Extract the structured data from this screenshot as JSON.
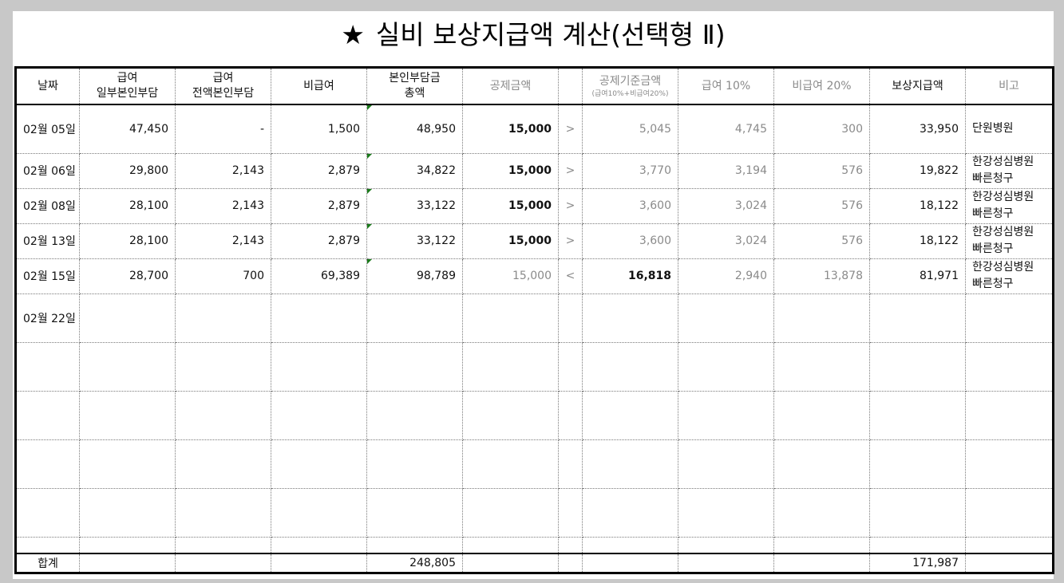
{
  "title": "실비 보상지급액 계산(선택형 Ⅱ)",
  "title_icon": "star-icon",
  "headers": {
    "date": "날짜",
    "part_self_1": "급여",
    "part_self_2": "일부본인부담",
    "full_self_1": "급여",
    "full_self_2": "전액본인부담",
    "non_covered": "비급여",
    "total_self_1": "본인부담금",
    "total_self_2": "총액",
    "deduction": "공제금액",
    "deduction_base": "공제기준금액",
    "deduction_base_note": "(급여10%+비급여20%)",
    "covered_10": "급여 10%",
    "non_covered_20": "비급여 20%",
    "payout": "보상지급액",
    "remarks": "비고"
  },
  "rows": [
    {
      "date": "02월 05일",
      "part": "47,450",
      "full": "-",
      "non": "1,500",
      "total": "48,950",
      "deduction": "15,000",
      "cmp": ">",
      "base": "5,045",
      "c10": "4,745",
      "n20": "300",
      "payout": "33,950",
      "note1": "단원병원",
      "note2": ""
    },
    {
      "date": "02월 06일",
      "part": "29,800",
      "full": "2,143",
      "non": "2,879",
      "total": "34,822",
      "deduction": "15,000",
      "cmp": ">",
      "base": "3,770",
      "c10": "3,194",
      "n20": "576",
      "payout": "19,822",
      "note1": "한강성심병원",
      "note2": "빠른청구"
    },
    {
      "date": "02월 08일",
      "part": "28,100",
      "full": "2,143",
      "non": "2,879",
      "total": "33,122",
      "deduction": "15,000",
      "cmp": ">",
      "base": "3,600",
      "c10": "3,024",
      "n20": "576",
      "payout": "18,122",
      "note1": "한강성심병원",
      "note2": "빠른청구"
    },
    {
      "date": "02월 13일",
      "part": "28,100",
      "full": "2,143",
      "non": "2,879",
      "total": "33,122",
      "deduction": "15,000",
      "cmp": ">",
      "base": "3,600",
      "c10": "3,024",
      "n20": "576",
      "payout": "18,122",
      "note1": "한강성심병원",
      "note2": "빠른청구"
    },
    {
      "date": "02월 15일",
      "part": "28,700",
      "full": "700",
      "non": "69,389",
      "total": "98,789",
      "deduction": "15,000",
      "cmp": "<",
      "base": "16,818",
      "c10": "2,940",
      "n20": "13,878",
      "payout": "81,971",
      "note1": "한강성심병원",
      "note2": "빠른청구"
    },
    {
      "date": "02월 22일",
      "part": "",
      "full": "",
      "non": "",
      "total": "",
      "deduction": "",
      "cmp": "",
      "base": "",
      "c10": "",
      "n20": "",
      "payout": "",
      "note1": "",
      "note2": ""
    }
  ],
  "totals": {
    "label": "합계",
    "total_self": "248,805",
    "payout": "171,987"
  }
}
